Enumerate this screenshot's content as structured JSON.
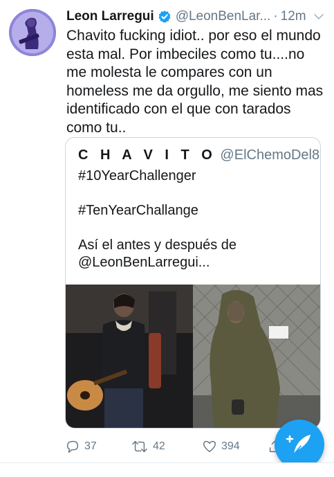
{
  "tweet": {
    "author_name": "Leon Larregui",
    "author_handle": "@LeonBenLar...",
    "separator": "·",
    "time": "12m",
    "text": "Chavito fucking idiot.. por eso el mundo esta mal. Por imbeciles como tu....no me molesta le compares con un homeless me da orgullo, me siento mas identificado con el que con tarados como tu..",
    "icons": {
      "verified": "verified-badge-icon",
      "menu": "chevron-down-icon"
    }
  },
  "quoted_tweet": {
    "author_name": "C H A V I T O",
    "author_handle": "@ElChemoDel8",
    "text": "#10YearChallenger\n\n#TenYearChallange\n\nAsí el antes y después de\n@LeonBenLarregui..."
  },
  "actions": {
    "replies": "37",
    "retweets": "42",
    "likes": "394"
  },
  "compose": {
    "icon": "compose-tweet-icon"
  },
  "colors": {
    "accent": "#1da1f2",
    "text": "#14171a",
    "secondary_text": "#657786",
    "border": "#ccd6dd"
  }
}
